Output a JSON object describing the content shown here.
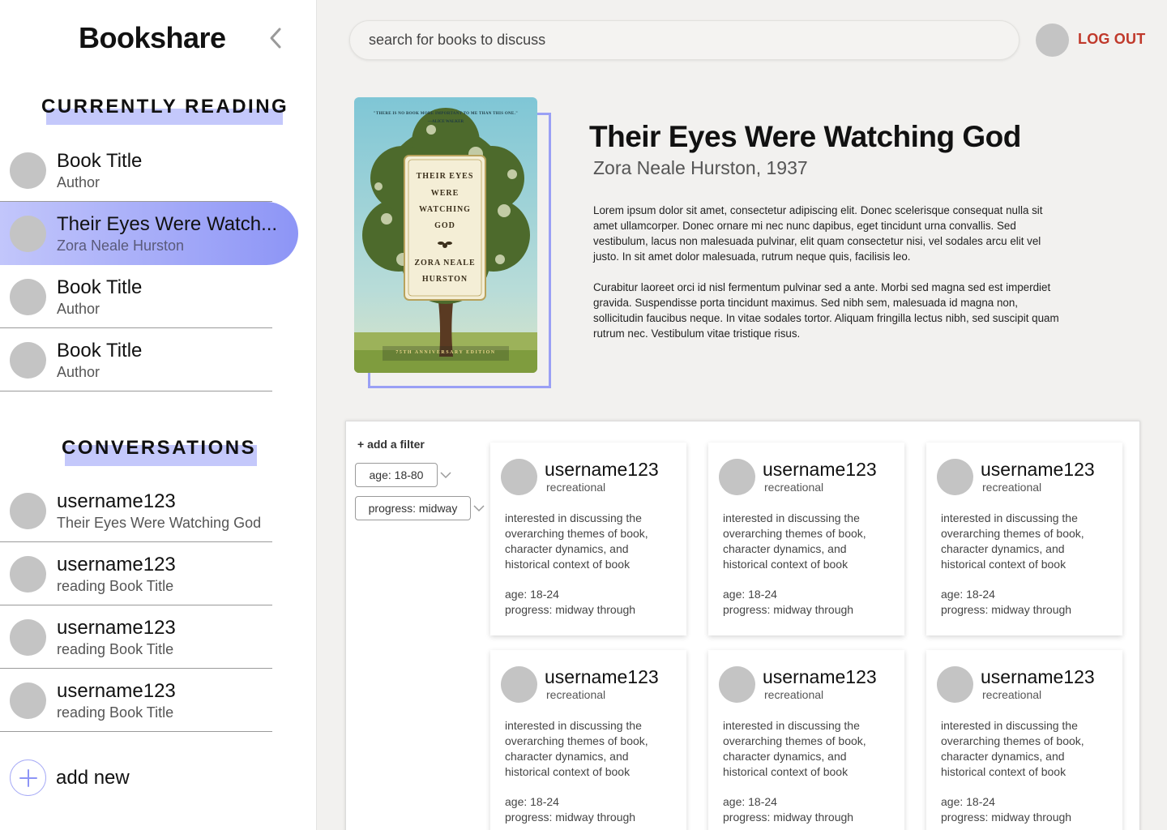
{
  "sidebar": {
    "brand": "Bookshare",
    "currently_reading_heading": "CURRENTLY READING",
    "reading": [
      {
        "title": "Book Title",
        "subtitle": "Author",
        "active": false
      },
      {
        "title": "Their Eyes Were Watch...",
        "subtitle": "Zora Neale Hurston",
        "active": true
      },
      {
        "title": "Book Title",
        "subtitle": "Author",
        "active": false
      },
      {
        "title": "Book Title",
        "subtitle": "Author",
        "active": false
      }
    ],
    "conversations_heading": "CONVERSATIONS",
    "conversations": [
      {
        "title": "username123",
        "subtitle": "Their Eyes Were Watching God"
      },
      {
        "title": "username123",
        "subtitle": "reading Book Title"
      },
      {
        "title": "username123",
        "subtitle": "reading Book Title"
      },
      {
        "title": "username123",
        "subtitle": "reading Book Title"
      }
    ],
    "add_new": "add new"
  },
  "header": {
    "search_placeholder": "search for books to discuss",
    "logout": "LOG OUT"
  },
  "book": {
    "title": "Their Eyes Were Watching God",
    "subtitle": "Zora Neale Hurston, 1937",
    "cover": {
      "quote": "\"THERE IS NO BOOK MORE IMPORTANT TO ME THAN THIS ONE.\"",
      "quote_author": "—ALICE WALKER",
      "lines": [
        "THEIR EYES",
        "WERE",
        "WATCHING",
        "GOD"
      ],
      "author_lines": [
        "ZORA NEALE",
        "HURSTON"
      ],
      "edition": "75TH ANNIVERSARY EDITION"
    },
    "description": [
      "Lorem ipsum dolor sit amet, consectetur adipiscing elit. Donec scelerisque consequat nulla sit amet ullamcorper. Donec ornare mi nec nunc dapibus, eget tincidunt urna convallis. Sed vestibulum, lacus non malesuada pulvinar, elit quam consectetur nisi, vel sodales arcu elit vel justo. In sit amet dolor malesuada, rutrum neque quis, facilisis leo.",
      "Curabitur laoreet orci id nisl fermentum pulvinar sed a ante. Morbi sed magna sed est imperdiet gravida. Suspendisse porta tincidunt maximus. Sed nibh sem, malesuada id magna non, sollicitudin faucibus neque. In vitae sodales tortor. Aliquam fringilla lectus nibh, sed suscipit quam rutrum nec. Vestibulum vitae tristique risus."
    ]
  },
  "filters": {
    "add_filter": "+ add a filter",
    "items": [
      "age: 18-80",
      "progress: midway"
    ]
  },
  "readers": [
    {
      "username": "username123",
      "type": "recreational",
      "bio": "interested in discussing the overarching themes of book, character dynamics,  and historical context of book",
      "age": "age: 18-24",
      "progress": "progress: midway through"
    },
    {
      "username": "username123",
      "type": "recreational",
      "bio": "interested in discussing the overarching themes of book, character dynamics,  and historical context of book",
      "age": "age: 18-24",
      "progress": "progress: midway through"
    },
    {
      "username": "username123",
      "type": "recreational",
      "bio": "interested in discussing the overarching themes of book, character dynamics,  and historical context of book",
      "age": "age: 18-24",
      "progress": "progress: midway through"
    },
    {
      "username": "username123",
      "type": "recreational",
      "bio": "interested in discussing the overarching themes of book, character dynamics,  and historical context of book",
      "age": "age: 18-24",
      "progress": "progress: midway through"
    },
    {
      "username": "username123",
      "type": "recreational",
      "bio": "interested in discussing the overarching themes of book, character dynamics,  and historical context of book",
      "age": "age: 18-24",
      "progress": "progress: midway through"
    },
    {
      "username": "username123",
      "type": "recreational",
      "bio": "interested in discussing the overarching themes of book, character dynamics,  and historical context of book",
      "age": "age: 18-24",
      "progress": "progress: midway through"
    }
  ],
  "colors": {
    "accent": "#8d95f6",
    "accent_light": "#c4c8fb",
    "logout": "#c0392b",
    "avatar": "#c4c4c4"
  },
  "icons": {
    "collapse": "chevron-left-icon",
    "add": "plus-icon",
    "dropdown": "chevron-down-icon"
  }
}
